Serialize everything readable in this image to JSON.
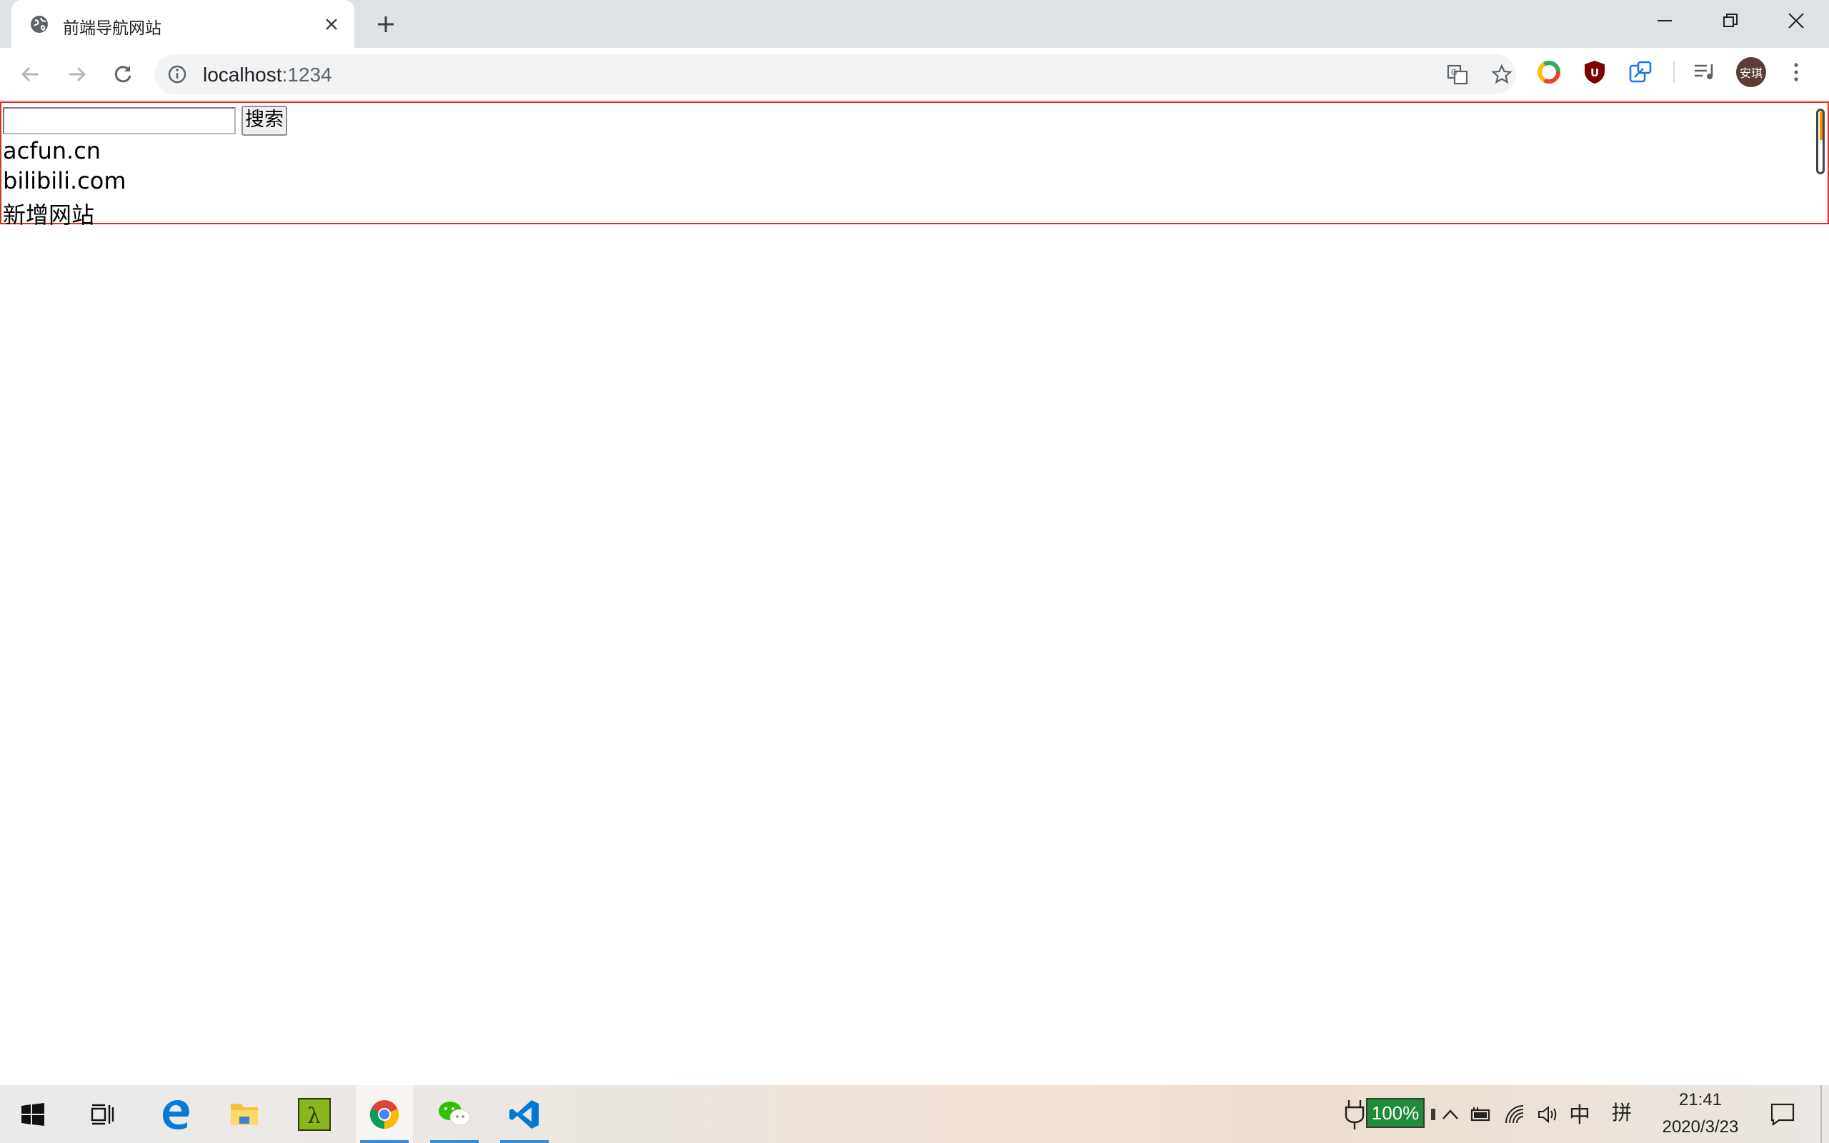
{
  "browser": {
    "tab": {
      "title": "前端导航网站",
      "favicon": "globe-icon"
    },
    "address": {
      "host": "localhost",
      "port": ":1234",
      "info_icon": "info-icon"
    },
    "profile": {
      "initials": "安琪"
    },
    "extensions": [
      "translate-icon",
      "star-icon",
      "chrome-ring-icon",
      "ublock-icon",
      "share-extension-icon",
      "media-control-icon"
    ]
  },
  "page": {
    "search": {
      "value": "",
      "button_label": "搜索"
    },
    "sites": [
      "acfun.cn",
      "bilibili.com"
    ],
    "add_label": "新增网站"
  },
  "taskbar": {
    "apps": [
      "windows-start-icon",
      "task-view-icon",
      "edge-icon",
      "file-explorer-icon",
      "lambda-app-icon",
      "chrome-icon",
      "wechat-icon",
      "vscode-icon"
    ],
    "battery": "100%",
    "ime_lang": "中",
    "ime_mode": "拼",
    "time": "21:41",
    "date": "2020/3/23"
  },
  "colors": {
    "box_border": "#d9322a",
    "tab_strip": "#dee1e6",
    "omnibox": "#f1f3f4"
  }
}
